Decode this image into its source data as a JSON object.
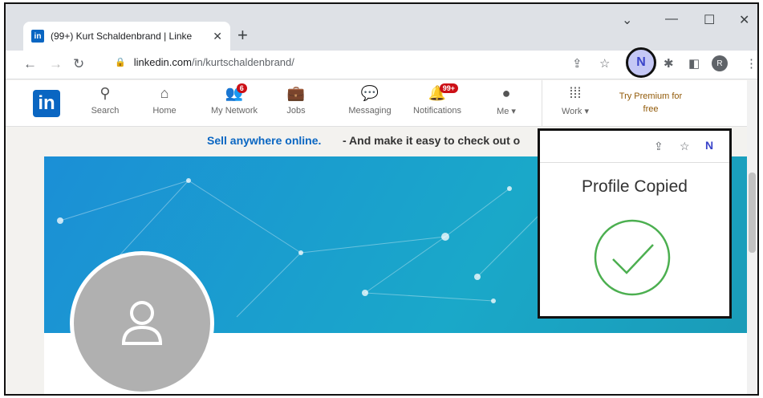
{
  "browser": {
    "tab_title": "(99+) Kurt Schaldenbrand | Linke",
    "tab_favicon": "in",
    "tab_close": "✕",
    "new_tab": "+",
    "url_host": "linkedin.com",
    "url_path": "/in/kurtschaldenbrand/",
    "extension_label": "N",
    "profile_initial": "R",
    "win_min": "—",
    "win_max": "☐",
    "win_close": "✕",
    "win_dropdown": "⌄"
  },
  "linkedin": {
    "logo": "in",
    "nav": [
      {
        "label": "Search",
        "icon": "search-icon"
      },
      {
        "label": "Home",
        "icon": "home-icon"
      },
      {
        "label": "My Network",
        "icon": "network-icon",
        "badge": "6"
      },
      {
        "label": "Jobs",
        "icon": "briefcase-icon"
      },
      {
        "label": "Messaging",
        "icon": "message-icon"
      },
      {
        "label": "Notifications",
        "icon": "bell-icon",
        "badge": "99+"
      },
      {
        "label": "Me ▾",
        "icon": "avatar-icon"
      },
      {
        "label": "Work ▾",
        "icon": "grid-icon"
      }
    ],
    "premium": "Try Premium for free"
  },
  "ad": {
    "link": "Sell anywhere online.",
    "text": "- And make it easy to check out o"
  },
  "popup": {
    "title": "Profile Copied",
    "ext_label": "N",
    "check_color": "#4caf50"
  },
  "colors": {
    "linkedin_blue": "#0a66c2",
    "badge_red": "#cc1016",
    "extension_purple": "#3a44c9"
  }
}
